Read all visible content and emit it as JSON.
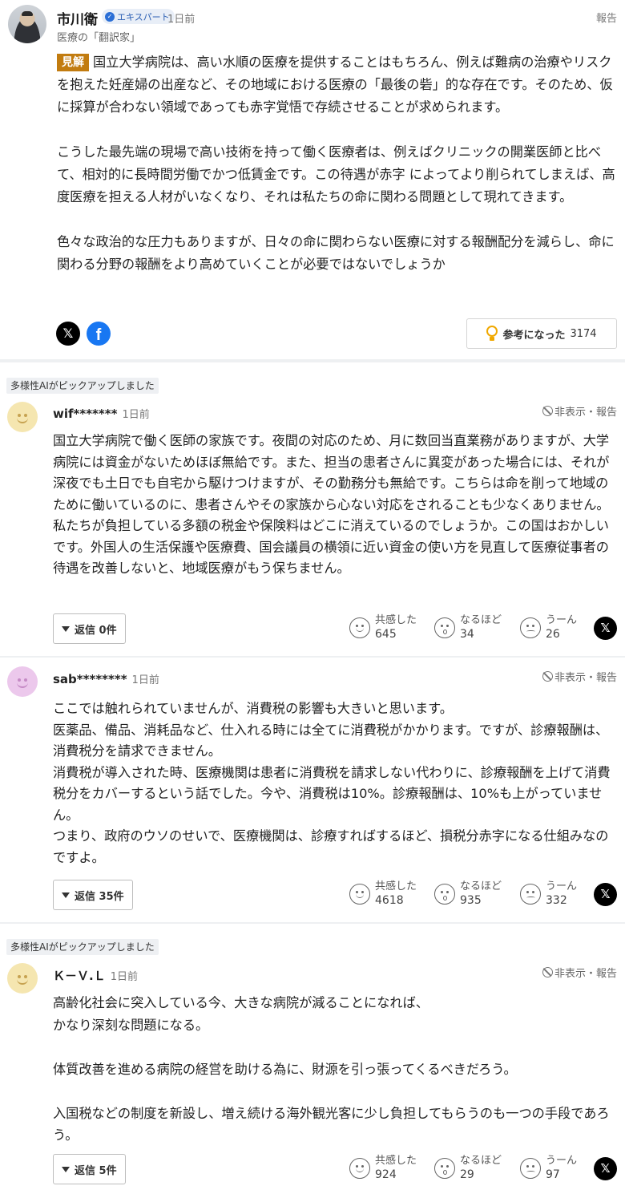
{
  "expert": {
    "name": "市川衛",
    "badge": "エキスパート",
    "time": "1日前",
    "report": "報告",
    "subtitle": "医療の「翻訳家」",
    "label": "見解",
    "paragraphs": [
      "国立大学病院は、高い水順の医療を提供することはもちろん、例えば難病の治療やリスクを抱えた妊産婦の出産など、その地域における医療の「最後の砦」的な存在です。そのため、仮に採算が合わない領域であっても赤字覚悟で存続させることが求められます。",
      "こうした最先端の現場で高い技術を持って働く医療者は、例えばクリニックの開業医師と比べて、相対的に長時間労働でかつ低賃金です。この待遇が赤字 によってより削られてしまえば、高度医療を担える人材がいなくなり、それは私たちの命に関わる問題として現れてきます。",
      "色々な政治的な圧力もありますが、日々の命に関わらない医療に対する報酬配分を減らし、命に関わる分野の報酬をより高めていくことが必要ではないでしょうか"
    ],
    "helpful_label": "参考になった",
    "helpful_count": "3174"
  },
  "pick_label": "多様性AIがピックアップしました",
  "hide_report": "非表示・報告",
  "reactions": {
    "empathy": "共感した",
    "indeed": "なるほど",
    "hmm": "うーん"
  },
  "comments": [
    {
      "user": "wif*******",
      "time": "1日前",
      "picked": true,
      "lines": [
        "国立大学病院で働く医師の家族です。夜間の対応のため、月に数回当直業務がありますが、大学病院には資金がないためほぼ無給です。また、担当の患者さんに異変があった場合には、それが深夜でも土日でも自宅から駆けつけますが、その勤務分も無給です。こちらは命を削って地域のために働いているのに、患者さんやその家族から心ない対応をされることも少なくありません。私たちが負担している多額の税金や保険料はどこに消えているのでしょうか。この国はおかしいです。外国人の生活保護や医療費、国会議員の横領に近い資金の使い方を見直して医療従事者の待遇を改善しないと、地域医療がもう保ちません。"
      ],
      "reply": "返信 0件",
      "empathy": "645",
      "indeed": "34",
      "hmm": "26"
    },
    {
      "user": "sab********",
      "time": "1日前",
      "picked": false,
      "lines": [
        "ここでは触れられていませんが、消費税の影響も大きいと思います。",
        "医薬品、備品、消耗品など、仕入れる時には全てに消費税がかかります。ですが、診療報酬は、消費税分を請求できません。",
        "消費税が導入された時、医療機関は患者に消費税を請求しない代わりに、診療報酬を上げて消費税分をカバーするという話でした。今や、消費税は10%。診療報酬は、10%も上がっていません。",
        "つまり、政府のウソのせいで、医療機関は、診療すればするほど、損税分赤字になる仕組みなのですよ。"
      ],
      "reply": "返信 35件",
      "empathy": "4618",
      "indeed": "935",
      "hmm": "332"
    },
    {
      "user": "Ｋ－Ｖ.Ｌ",
      "time": "1日前",
      "picked": true,
      "lines": [
        "高齢化社会に突入している今、大きな病院が減ることになれば、",
        "かなり深刻な問題になる。",
        "",
        "体質改善を進める病院の経営を助ける為に、財源を引っ張ってくるべきだろう。",
        "",
        "入国税などの制度を新設し、増え続ける海外観光客に少し負担してもらうのも一つの手段であろう。"
      ],
      "reply": "返信 5件",
      "empathy": "924",
      "indeed": "29",
      "hmm": "97"
    }
  ],
  "icons": {
    "x": "𝕏",
    "facebook": "f"
  }
}
